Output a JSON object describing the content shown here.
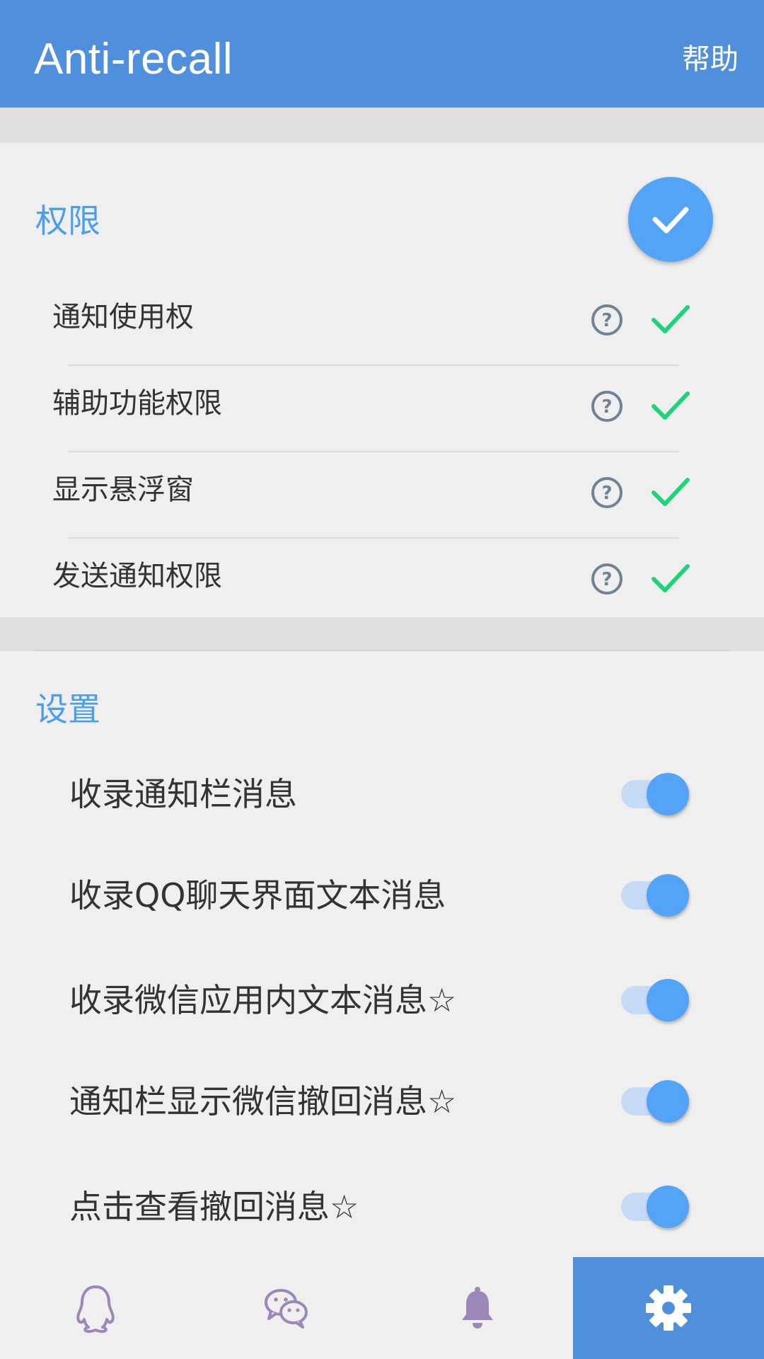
{
  "app": {
    "title": "Anti-recall",
    "help_label": "帮助"
  },
  "permissions": {
    "title": "权限",
    "items": [
      {
        "label": "通知使用权",
        "granted": true
      },
      {
        "label": "辅助功能权限",
        "granted": true
      },
      {
        "label": "显示悬浮窗",
        "granted": true
      },
      {
        "label": "发送通知权限",
        "granted": true
      }
    ]
  },
  "settings": {
    "title": "设置",
    "items": [
      {
        "label": "收录通知栏消息",
        "enabled": true
      },
      {
        "label": "收录QQ聊天界面文本消息",
        "enabled": true
      },
      {
        "label": "收录微信应用内文本消息☆",
        "enabled": true
      },
      {
        "label": "通知栏显示微信撤回消息☆",
        "enabled": true
      },
      {
        "label": "点击查看撤回消息☆",
        "enabled": true
      }
    ]
  },
  "bottom_nav": {
    "items": [
      {
        "icon": "qq-icon",
        "active": false
      },
      {
        "icon": "wechat-icon",
        "active": false
      },
      {
        "icon": "bell-icon",
        "active": false
      },
      {
        "icon": "gear-icon",
        "active": true
      }
    ]
  },
  "colors": {
    "primary": "#4f8fdb",
    "accent": "#53a3f7",
    "section_title": "#4a9ef0",
    "check_green": "#1fd37a",
    "nav_icon": "#9d87b8"
  }
}
